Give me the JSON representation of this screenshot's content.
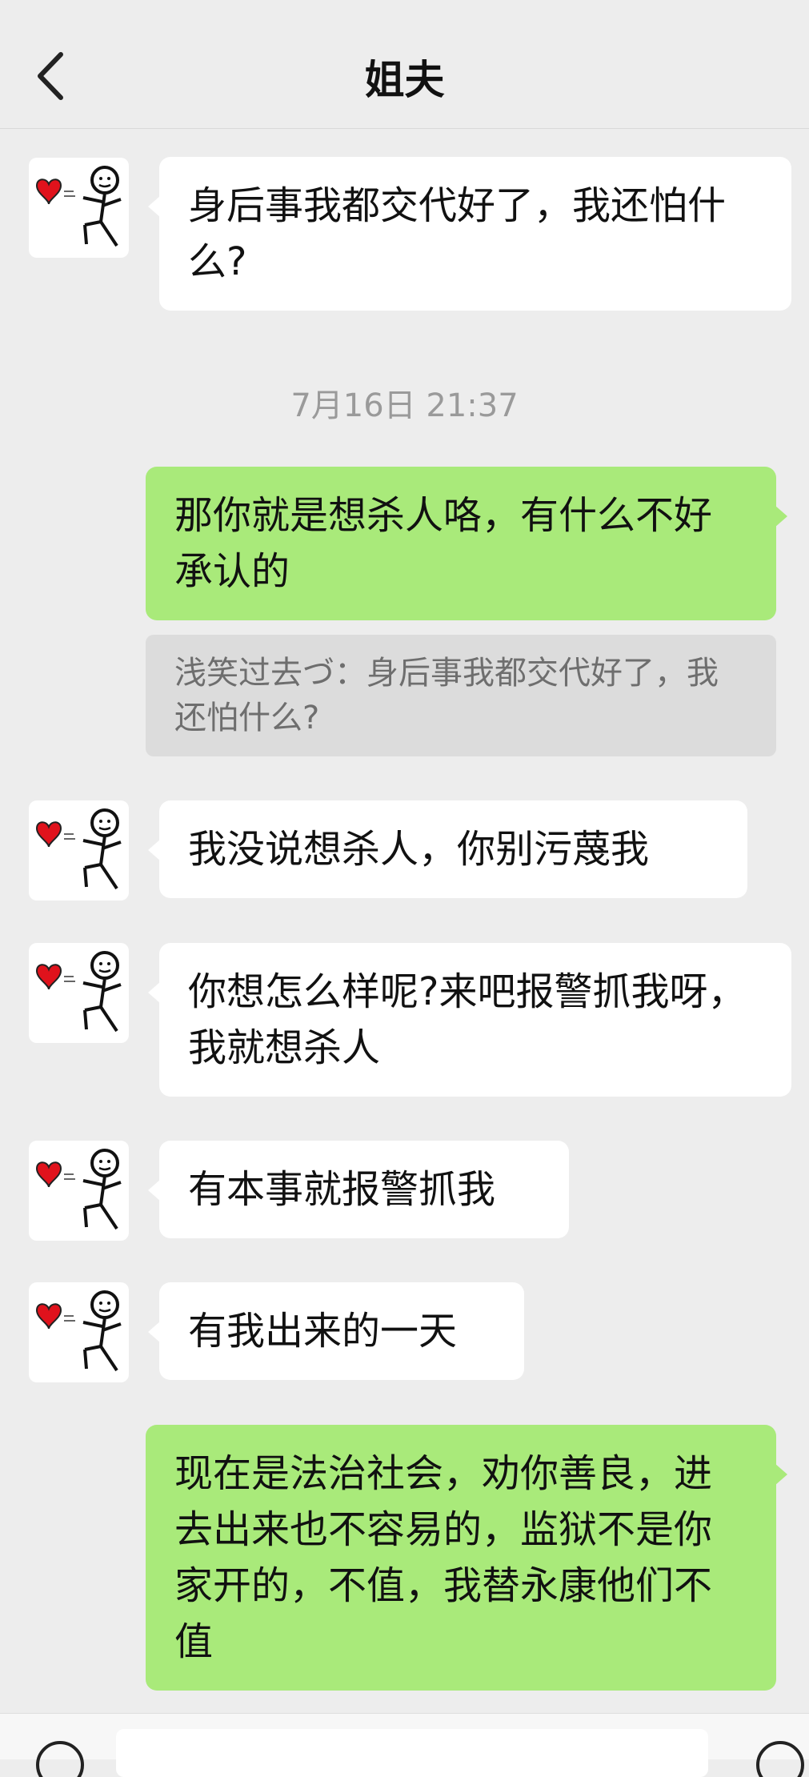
{
  "header": {
    "title": "姐夫",
    "back_icon": "chevron-left-icon"
  },
  "messages": [
    {
      "side": "left",
      "text": "身后事我都交代好了，我还怕什么?"
    },
    {
      "type": "timestamp",
      "text": "7月16日 21:37"
    },
    {
      "side": "right",
      "text": "那你就是想杀人咯，有什么不好承认的",
      "quote": "浅笑过去づ：身后事我都交代好了，我还怕什么?"
    },
    {
      "side": "left",
      "text": "我没说想杀人，你别污蔑我"
    },
    {
      "side": "left",
      "text": "你想怎么样呢?来吧报警抓我呀，我就想杀人"
    },
    {
      "side": "left",
      "text": "有本事就报警抓我"
    },
    {
      "side": "left",
      "text": "有我出来的一天"
    },
    {
      "side": "right",
      "text": "现在是法治社会，劝你善良，进去出来也不容易的，监狱不是你家开的，不值，我替永康他们不值"
    }
  ],
  "colors": {
    "background": "#ededed",
    "outgoing": "#a9ea7a",
    "incoming": "#ffffff",
    "accent_heart": "#e0121c"
  }
}
